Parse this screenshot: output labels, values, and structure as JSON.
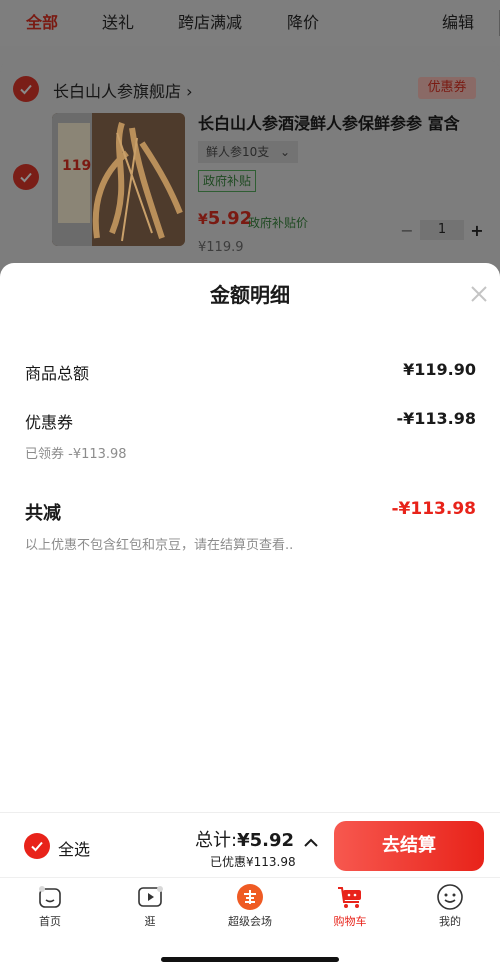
{
  "tabs": {
    "all": "全部",
    "gift": "送礼",
    "cross_store": "跨店满减",
    "price_drop": "降价",
    "edit": "编辑"
  },
  "store": {
    "name": "长白山人参旗舰店",
    "chevron": "›",
    "coupon_tag": "优惠券"
  },
  "product": {
    "title": "长白山人参酒浸鲜人参保鲜参参 富含",
    "sku": "鲜人参10支",
    "gov_badge": "政府补贴",
    "price_symbol": "¥",
    "price_value": "5.92",
    "price_note": "政府补贴价",
    "original_price": "¥119.9",
    "quantity": "1",
    "minus": "−",
    "plus": "+",
    "image_text": "119"
  },
  "sheet": {
    "title": "金额明细",
    "goods_total_label": "商品总额",
    "goods_total_value": "¥119.90",
    "coupon_label": "优惠券",
    "coupon_value": "-¥113.98",
    "coupon_claimed": "已领券 -¥113.98",
    "total_reduce_label": "共减",
    "total_reduce_value": "-¥113.98",
    "disclaimer": "以上优惠不包含红包和京豆，请在结算页查看.."
  },
  "footer": {
    "select_all": "全选",
    "sum_label": "总计:",
    "sum_value": "¥5.92",
    "saved": "已优惠¥113.98",
    "checkout": "去结算"
  },
  "nav": {
    "home": "首页",
    "browse": "逛",
    "super": "超级会场",
    "cart": "购物车",
    "mine": "我的"
  },
  "colors": {
    "accent": "#e8231a",
    "sheet_bg": "#ffffff",
    "overlay": "#7d7d7d"
  },
  "icons": [
    "check-icon",
    "chevron-right-icon",
    "chevron-down-icon",
    "close-icon",
    "chevron-up-icon",
    "home-icon",
    "play-icon",
    "super-venue-icon",
    "cart-icon",
    "smile-icon"
  ]
}
